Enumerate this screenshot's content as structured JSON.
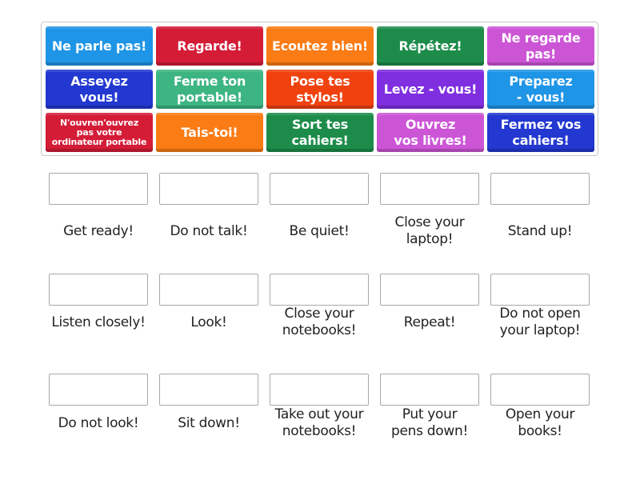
{
  "tiles": [
    {
      "text": "Ne parle pas!",
      "color": "#1e95e6"
    },
    {
      "text": "Regarde!",
      "color": "#d41c37"
    },
    {
      "text": "Ecoutez bien!",
      "color": "#fb7b14"
    },
    {
      "text": "Répétez!",
      "color": "#1d8c4a"
    },
    {
      "text": "Ne regarde\npas!",
      "color": "#cc55d6"
    },
    {
      "text": "Asseyez\nvous!",
      "color": "#2238d0"
    },
    {
      "text": "Ferme ton\nportable!",
      "color": "#3db583"
    },
    {
      "text": "Pose tes\nstylos!",
      "color": "#f0420f"
    },
    {
      "text": "Levez - vous!",
      "color": "#7f2ee0"
    },
    {
      "text": "Preparez\n- vous!",
      "color": "#1e95e6"
    },
    {
      "text": "N'ouvren'ouvrez\npas votre\nordinateur portable",
      "color": "#d41c37",
      "small": true
    },
    {
      "text": "Tais-toi!",
      "color": "#fb7b14"
    },
    {
      "text": "Sort tes\ncahiers!",
      "color": "#1d8c4a"
    },
    {
      "text": "Ouvrez\nvos livres!",
      "color": "#cc55d6"
    },
    {
      "text": "Fermez vos\ncahiers!",
      "color": "#2238d0"
    }
  ],
  "targets": [
    {
      "label": "Get ready!"
    },
    {
      "label": "Do not talk!"
    },
    {
      "label": "Be quiet!"
    },
    {
      "label": "Close your\nlaptop!"
    },
    {
      "label": "Stand up!"
    },
    {
      "label": "Listen closely!"
    },
    {
      "label": "Look!"
    },
    {
      "label": "Close your\nnotebooks!"
    },
    {
      "label": "Repeat!"
    },
    {
      "label": "Do not open\nyour laptop!"
    },
    {
      "label": "Do not look!"
    },
    {
      "label": "Sit down!"
    },
    {
      "label": "Take out your\nnotebooks!"
    },
    {
      "label": "Put your\npens down!"
    },
    {
      "label": "Open your\nbooks!"
    }
  ]
}
